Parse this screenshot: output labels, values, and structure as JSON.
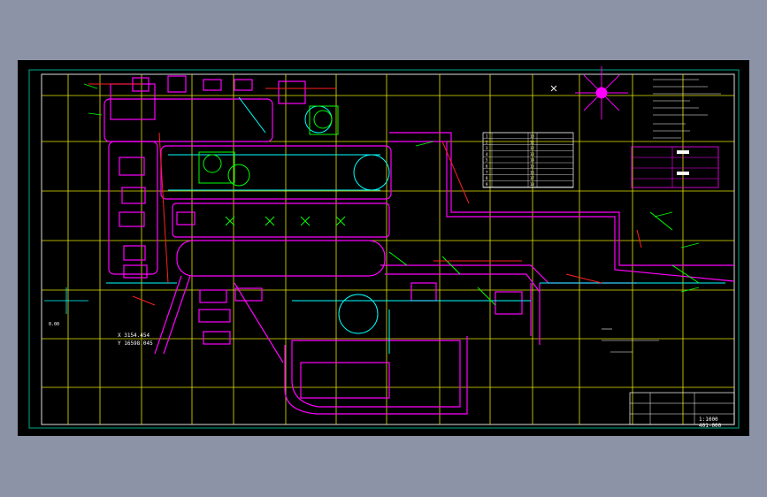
{
  "drawing": {
    "background": "#000000",
    "colors": {
      "grid": "#e6e600",
      "road": "#ff00ff",
      "pipe_cyan": "#00ffff",
      "pipe_green": "#00ff00",
      "pipe_red": "#ff2020",
      "text": "#ffffff",
      "north": "#ff00ff"
    },
    "coordinates": {
      "x": "X 3154.454",
      "y": "Y 16598.045"
    },
    "survey_label": "0.00",
    "legend_title": "",
    "legend_rows": [
      "1",
      "2",
      "3",
      "4",
      "5",
      "6",
      "7",
      "8",
      "9"
    ],
    "legend_right_rows": [
      "10",
      "11",
      "12",
      "13",
      "14",
      "15",
      "16",
      "17",
      "18"
    ],
    "title_block": {
      "scale": "1:1000",
      "drawing_no": "401-000"
    }
  }
}
